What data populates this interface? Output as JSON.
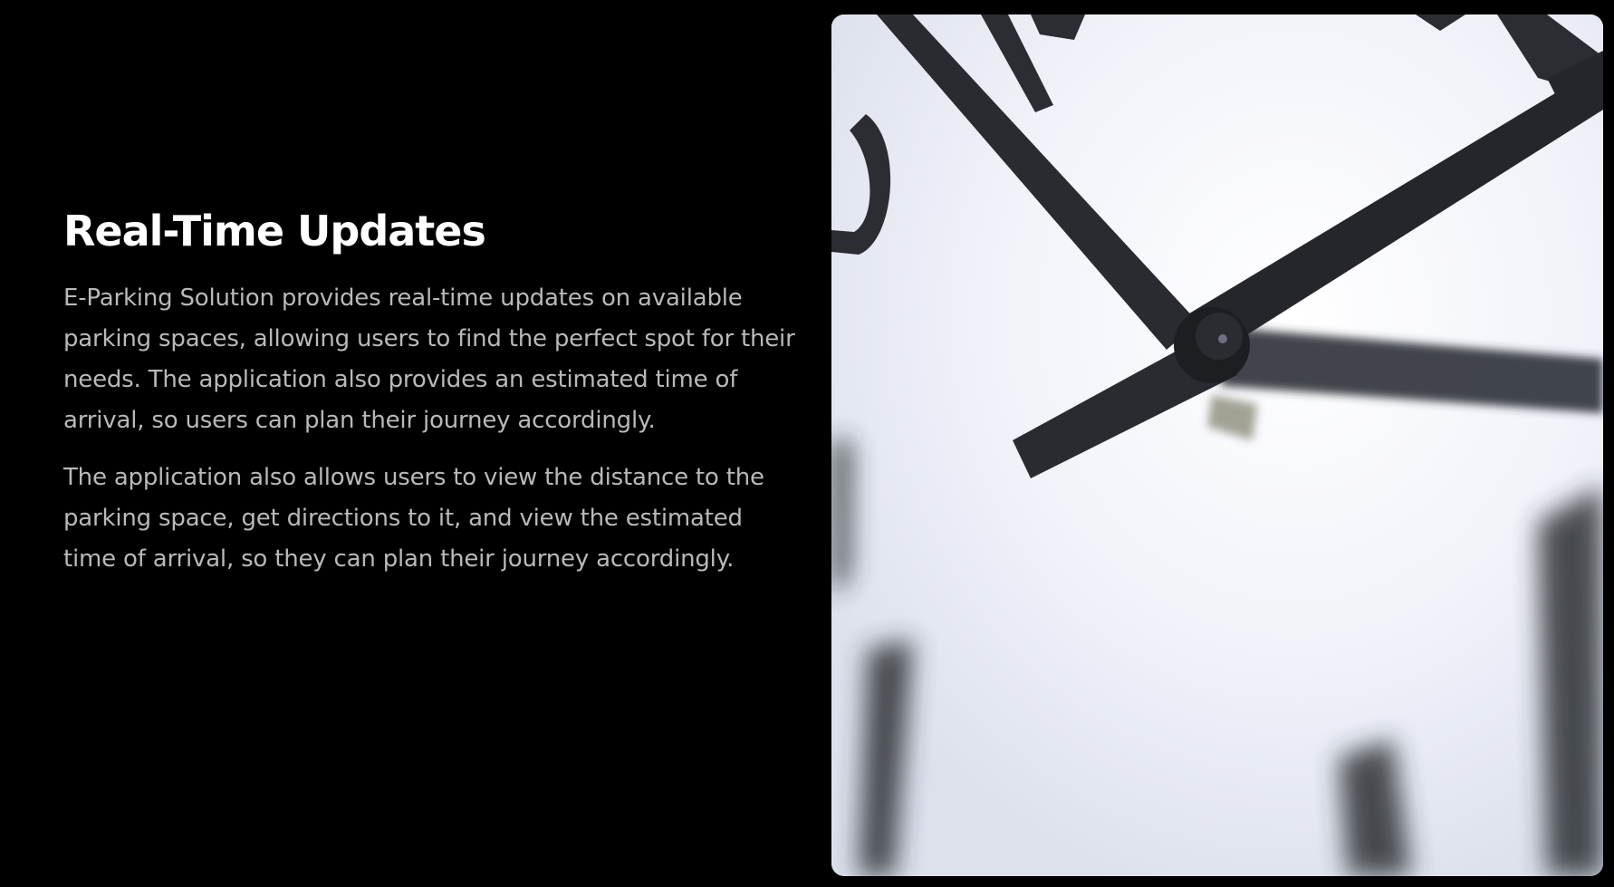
{
  "section": {
    "heading": "Real-Time Updates",
    "paragraphs": [
      "E-Parking Solution provides real-time updates on available parking spaces, allowing users to find the perfect spot for their needs. The application also provides an estimated time of arrival, so users can plan their journey accordingly.",
      "The application also allows users to view the distance to the parking space, get directions to it, and view the estimated time of arrival, so they can plan their journey accordingly."
    ]
  },
  "image": {
    "subject": "clock-face-closeup"
  },
  "colors": {
    "background": "#000000",
    "heading": "#ffffff",
    "body_text": "#b9b9b9",
    "clock_hands": "#2a2b30"
  }
}
